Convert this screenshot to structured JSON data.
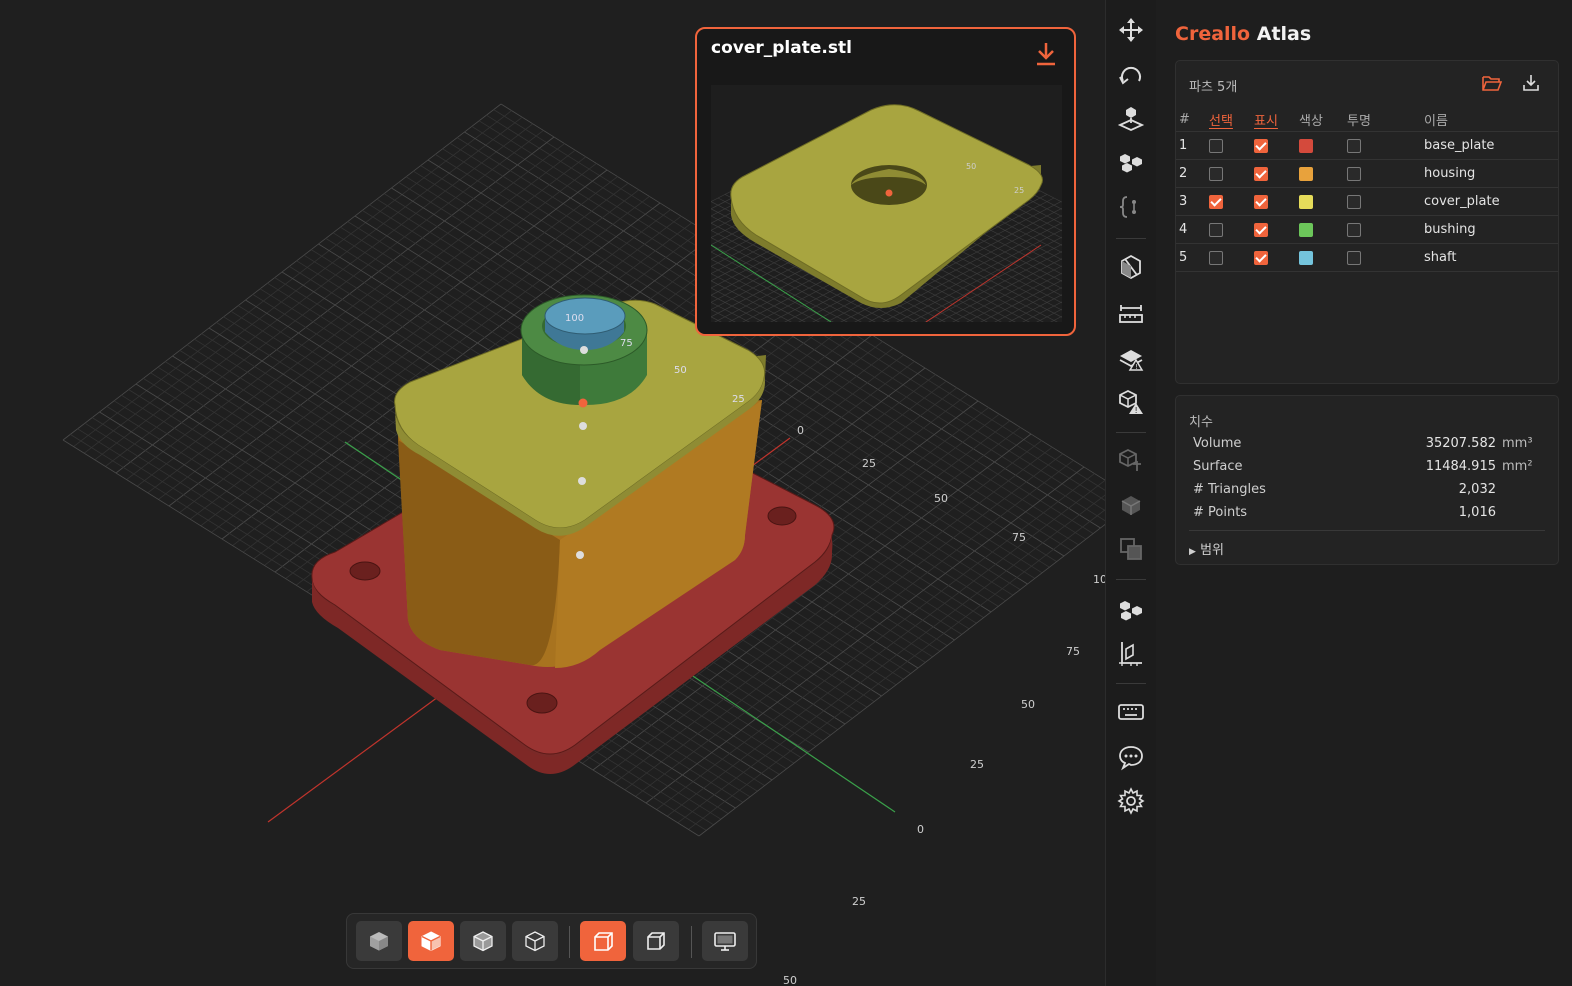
{
  "app": {
    "brand_part1": "Creallo",
    "brand_part2": "Atlas"
  },
  "preview": {
    "title": "cover_plate.stl"
  },
  "parts": {
    "header": "파츠 5개",
    "columns": [
      "#",
      "선택",
      "표시",
      "색상",
      "투명",
      "이름"
    ],
    "rows": [
      {
        "index": "1",
        "selected": false,
        "visible": true,
        "color": "#d44a3c",
        "transparent": false,
        "name": "base_plate"
      },
      {
        "index": "2",
        "selected": false,
        "visible": true,
        "color": "#e8a23c",
        "transparent": false,
        "name": "housing"
      },
      {
        "index": "3",
        "selected": true,
        "visible": true,
        "color": "#e6dc5a",
        "transparent": false,
        "name": "cover_plate"
      },
      {
        "index": "4",
        "selected": false,
        "visible": true,
        "color": "#6cc65a",
        "transparent": false,
        "name": "bushing"
      },
      {
        "index": "5",
        "selected": false,
        "visible": true,
        "color": "#74c4dc",
        "transparent": false,
        "name": "shaft"
      }
    ]
  },
  "dims": {
    "header": "치수",
    "volume_label": "Volume",
    "volume_value": "35207.582",
    "volume_unit": "mm³",
    "surface_label": "Surface",
    "surface_value": "11484.915",
    "surface_unit": "mm²",
    "triangles_label": "# Triangles",
    "triangles_value": "2,032",
    "points_label": "# Points",
    "points_value": "1,016",
    "range_label": "범위"
  },
  "viewport": {
    "axis_ticks_a": [
      "0",
      "25",
      "50",
      "75",
      "10"
    ],
    "axis_ticks_b": [
      "75",
      "50",
      "25",
      "0",
      "25",
      "50"
    ],
    "model_labels": [
      "100",
      "75",
      "50",
      "25"
    ],
    "preview_labels": [
      "50",
      "25"
    ]
  },
  "colors": {
    "accent": "#f0643c",
    "base_plate": "#9a3432",
    "housing": "#a8731f",
    "cover_plate": "#a8a540",
    "bushing": "#3e7a3a",
    "shaft": "#4d8fb0"
  },
  "icons": {
    "toolbar": [
      "move-icon",
      "rotate-icon",
      "place-on-face-icon",
      "arrange-icon",
      "code-icon",
      "cut-icon",
      "measure-icon",
      "slice-icon",
      "mesh-warning-icon",
      "mesh-repair-icon",
      "hollow-icon",
      "boolean-icon",
      "parts-icon",
      "section-icon",
      "keyboard-icon",
      "chat-icon",
      "settings-icon"
    ],
    "bottom": [
      "solid-view-icon",
      "shaded-view-icon",
      "xray-view-icon",
      "wireframe-view-icon",
      "perspective-icon",
      "orthographic-icon",
      "display-icon"
    ]
  }
}
